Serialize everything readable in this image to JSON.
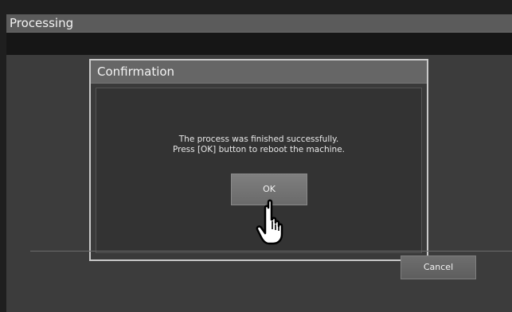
{
  "window": {
    "title": "Processing"
  },
  "dialog": {
    "title": "Confirmation",
    "message_line1": "The process was finished successfully.",
    "message_line2": "Press [OK] button to reboot the machine.",
    "ok_label": "OK"
  },
  "footer": {
    "cancel_label": "Cancel"
  },
  "overlay": {
    "pointer_icon": "hand-pointer-icon"
  }
}
